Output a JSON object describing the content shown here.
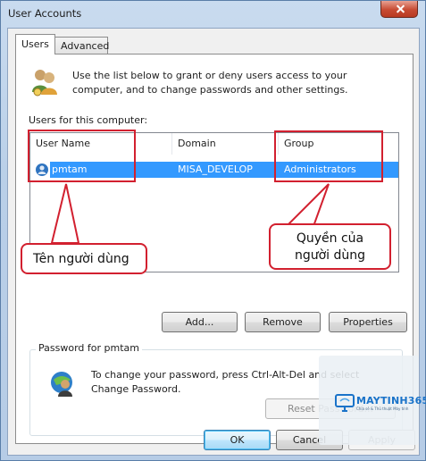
{
  "window": {
    "title": "User Accounts"
  },
  "tabs": [
    {
      "label": "Users"
    },
    {
      "label": "Advanced"
    }
  ],
  "intro": {
    "text": "Use the list below to grant or deny users access to your computer, and to change passwords and other settings."
  },
  "users_list": {
    "label": "Users for this computer:",
    "columns": [
      "User Name",
      "Domain",
      "Group"
    ],
    "rows": [
      {
        "name": "pmtam",
        "domain": "MISA_DEVELOP",
        "group": "Administrators"
      }
    ]
  },
  "list_buttons": {
    "add": "Add...",
    "remove": "Remove",
    "properties": "Properties"
  },
  "password": {
    "group_title": "Password for pmtam",
    "text": "To change your password, press Ctrl-Alt-Del and select Change Password.",
    "reset_button": "Reset Password..."
  },
  "dialog_buttons": {
    "ok": "OK",
    "cancel": "Cancel",
    "apply": "Apply"
  },
  "annotations": {
    "username_callout": "Tên người dùng",
    "permission_callout_line1": "Quyền của",
    "permission_callout_line2": "người dùng",
    "color": "#d2202f"
  },
  "watermark": {
    "brand": "MAYTINH365",
    "tagline": "Chia sẻ & Thủ thuật Máy tính"
  },
  "colors": {
    "selection": "#3399ff",
    "annotation_red": "#d2202f"
  }
}
